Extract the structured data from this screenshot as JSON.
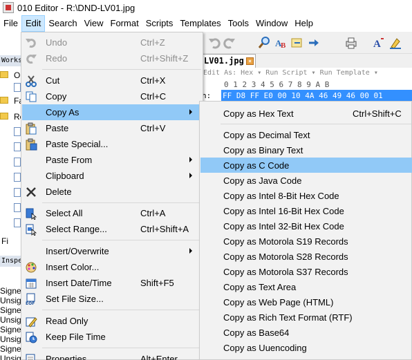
{
  "window": {
    "title": "010 Editor - R:\\DND-LV01.jpg"
  },
  "menubar": {
    "items": [
      "File",
      "Edit",
      "Search",
      "View",
      "Format",
      "Scripts",
      "Templates",
      "Tools",
      "Window",
      "Help"
    ],
    "active": "Edit"
  },
  "left_panel": {
    "workspace_header": "Works",
    "rows": [
      "O",
      "Fa",
      "Re"
    ],
    "fi_label": "Fi",
    "inspector_header": "Inspe",
    "inspector_rows": [
      "Signe",
      "Unsig",
      "Signe",
      "Unsig",
      "Signe",
      "Unsig",
      "Signe",
      "Unsig"
    ]
  },
  "editor": {
    "tab_label": "LV01.jpg",
    "hex_toolbar": "Edit As: Hex ▾   Run Script ▾   Run Template ▾",
    "ruler": "0  1  2  3  4  5  6  7  8  9  A  B",
    "first_row_addr": "h:",
    "first_row_bytes": "FF D8 FF E0 00 10 4A 46 49 46 00 01"
  },
  "edit_menu": {
    "items": [
      {
        "label": "Undo",
        "shortcut": "Ctrl+Z",
        "icon": "undo-icon",
        "disabled": true
      },
      {
        "label": "Redo",
        "shortcut": "Ctrl+Shift+Z",
        "icon": "redo-icon",
        "disabled": true
      },
      {
        "label": "Cut",
        "shortcut": "Ctrl+X",
        "icon": "scissors-icon"
      },
      {
        "label": "Copy",
        "shortcut": "Ctrl+C",
        "icon": "copy-icon"
      },
      {
        "label": "Copy As",
        "shortcut": "",
        "icon": "",
        "submenu": true,
        "highlighted": true
      },
      {
        "label": "Paste",
        "shortcut": "Ctrl+V",
        "icon": "clipboard-icon"
      },
      {
        "label": "Paste Special...",
        "shortcut": "",
        "icon": "paste-special-icon"
      },
      {
        "label": "Paste From",
        "shortcut": "",
        "icon": "",
        "submenu": true
      },
      {
        "label": "Clipboard",
        "shortcut": "",
        "icon": "",
        "submenu": true
      },
      {
        "label": "Delete",
        "shortcut": "",
        "icon": "delete-x-icon"
      },
      {
        "label": "Select All",
        "shortcut": "Ctrl+A",
        "icon": "select-all-icon"
      },
      {
        "label": "Select Range...",
        "shortcut": "Ctrl+Shift+A",
        "icon": "select-range-icon"
      },
      {
        "label": "Insert/Overwrite",
        "shortcut": "",
        "icon": "",
        "submenu": true
      },
      {
        "label": "Insert Color...",
        "shortcut": "",
        "icon": "palette-icon"
      },
      {
        "label": "Insert Date/Time",
        "shortcut": "Shift+F5",
        "icon": "calendar-icon"
      },
      {
        "label": "Set File Size...",
        "shortcut": "",
        "icon": "file-size-icon"
      },
      {
        "label": "Read Only",
        "shortcut": "",
        "icon": "lock-pencil-icon"
      },
      {
        "label": "Keep File Time",
        "shortcut": "",
        "icon": "file-time-icon"
      },
      {
        "label": "Properties",
        "shortcut": "Alt+Enter",
        "icon": "properties-icon"
      }
    ]
  },
  "copy_as_submenu": {
    "items": [
      {
        "label": "Copy as Hex Text",
        "shortcut": "Ctrl+Shift+C"
      },
      {
        "label": "Copy as Decimal Text",
        "shortcut": ""
      },
      {
        "label": "Copy as Binary Text",
        "shortcut": ""
      },
      {
        "label": "Copy as C Code",
        "shortcut": "",
        "highlighted": true
      },
      {
        "label": "Copy as Java Code",
        "shortcut": ""
      },
      {
        "label": "Copy as Intel 8-Bit Hex Code",
        "shortcut": ""
      },
      {
        "label": "Copy as Intel 16-Bit Hex Code",
        "shortcut": ""
      },
      {
        "label": "Copy as Intel 32-Bit Hex Code",
        "shortcut": ""
      },
      {
        "label": "Copy as Motorola S19 Records",
        "shortcut": ""
      },
      {
        "label": "Copy as Motorola S28 Records",
        "shortcut": ""
      },
      {
        "label": "Copy as Motorola S37 Records",
        "shortcut": ""
      },
      {
        "label": "Copy as Text Area",
        "shortcut": ""
      },
      {
        "label": "Copy as Web Page (HTML)",
        "shortcut": ""
      },
      {
        "label": "Copy as Rich Text Format (RTF)",
        "shortcut": ""
      },
      {
        "label": "Copy as Base64",
        "shortcut": ""
      },
      {
        "label": "Copy as Uuencoding",
        "shortcut": ""
      }
    ]
  }
}
